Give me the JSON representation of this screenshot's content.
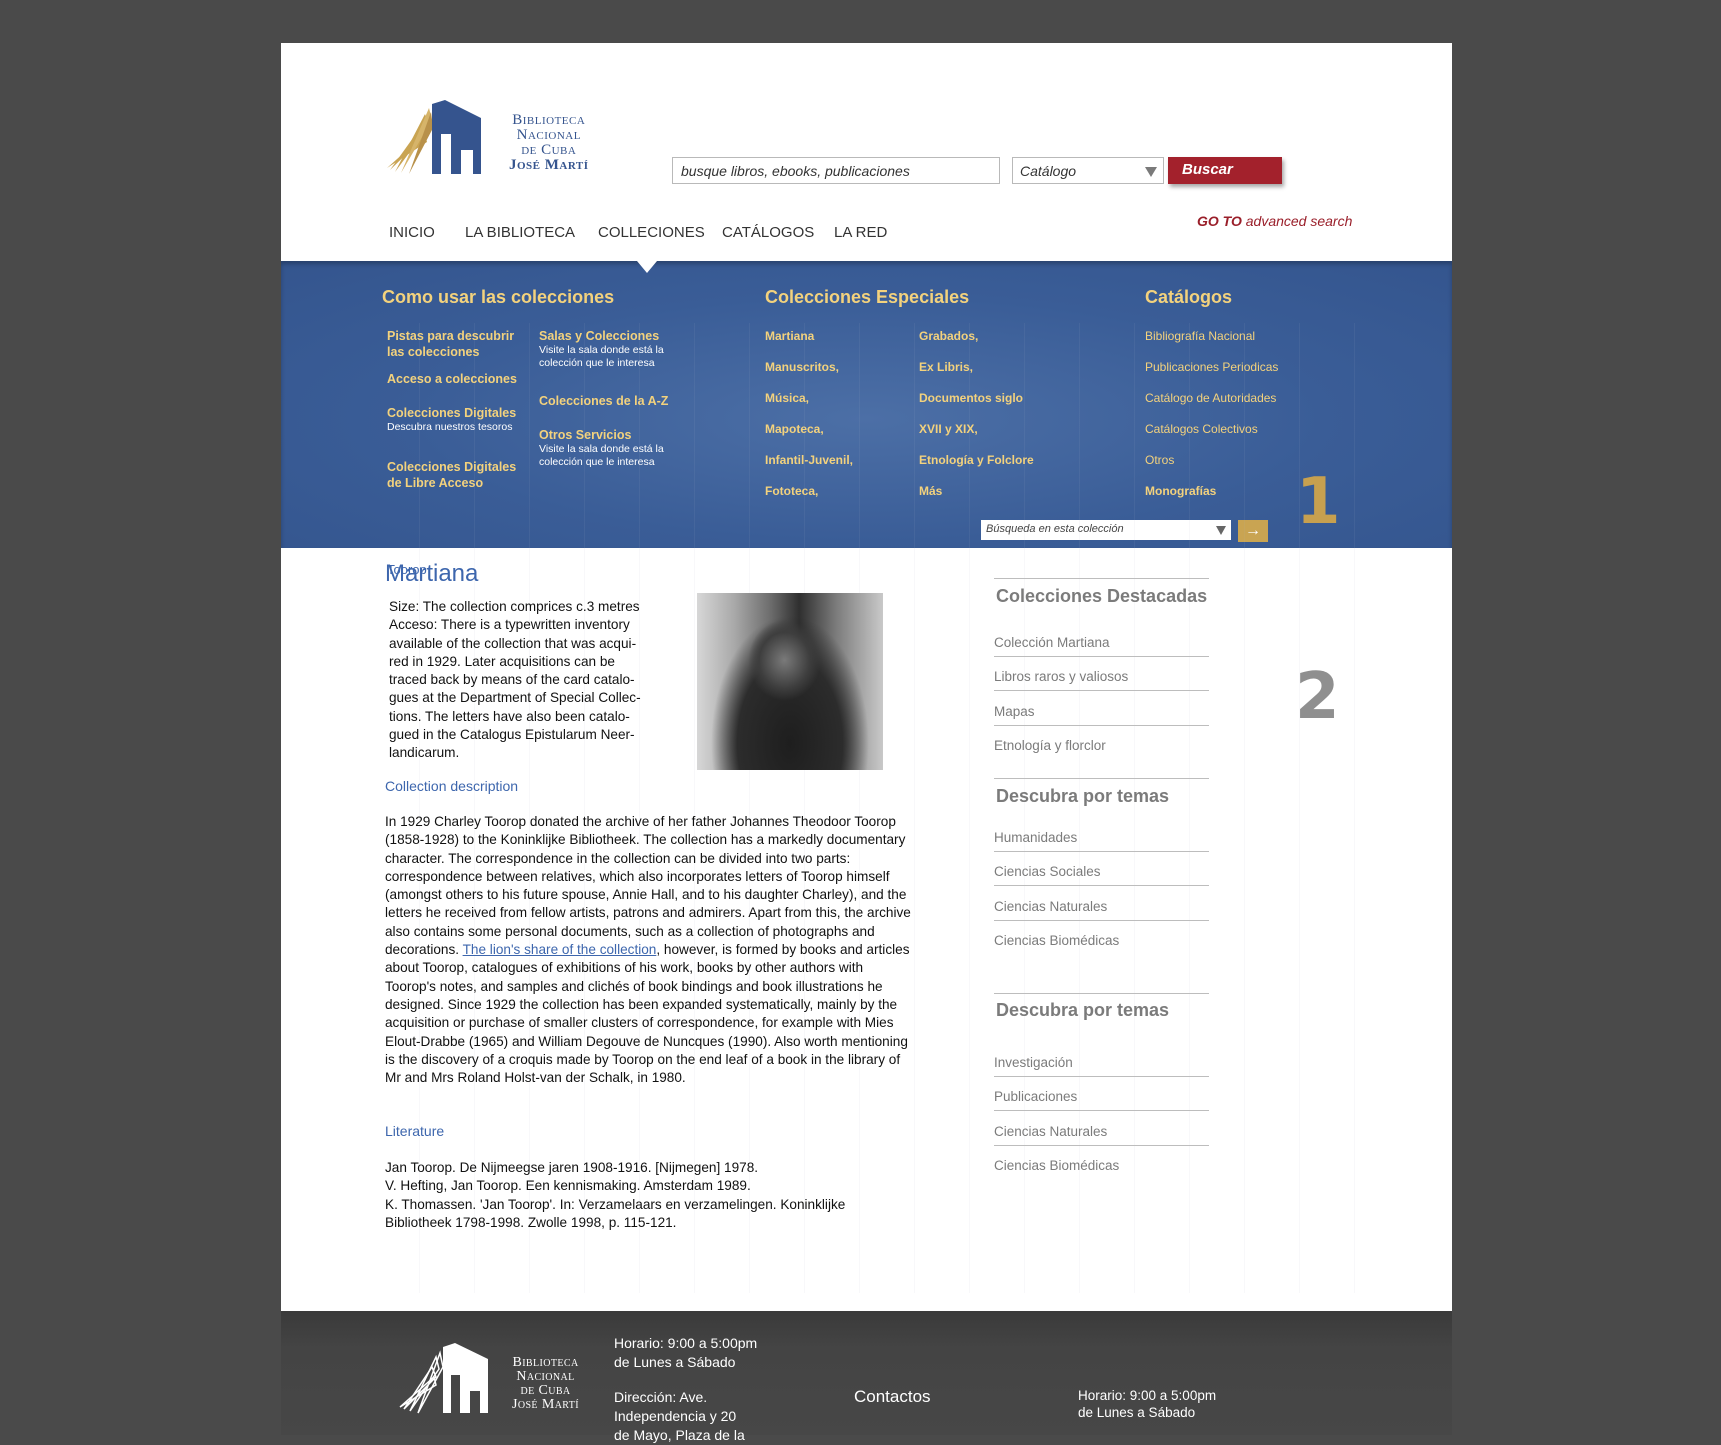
{
  "header": {
    "logo_lines": [
      "Biblioteca",
      "Nacional",
      "de Cuba",
      "José Martí"
    ],
    "search_placeholder": "busque libros, ebooks, publicaciones",
    "catalog_select": "Catálogo",
    "search_button": "Buscar",
    "advanced_go": "GO TO",
    "advanced_text": "advanced search"
  },
  "nav": [
    "INICIO",
    "LA BIBLIOTECA",
    "COLLECIONES",
    "CATÁLOGOS",
    "LA RED"
  ],
  "mega": {
    "col1_title": "Como usar las colecciones",
    "col1a": [
      {
        "label": "Pistas para descubrir las colecciones",
        "sub": ""
      },
      {
        "label": "Acceso a colecciones",
        "sub": ""
      },
      {
        "label": "Colecciones Digitales",
        "sub": "Descubra nuestros tesoros"
      },
      {
        "label": "Colecciones Digitales de Libre Acceso",
        "sub": ""
      }
    ],
    "col1b": [
      {
        "label": "Salas y Colecciones",
        "sub": "Visite la sala donde está la colección que le interesa"
      },
      {
        "label": "Colecciones de la A-Z",
        "sub": ""
      },
      {
        "label": "Otros Servicios",
        "sub": "Visite la sala donde está la colección que le interesa"
      }
    ],
    "col2_title": "Colecciones Especiales",
    "col2a": [
      "Martiana",
      "Manuscritos,",
      "Música,",
      "Mapoteca,",
      "Infantil-Juvenil,",
      "Fototeca,"
    ],
    "col2b": [
      "Grabados,",
      "Ex Libris,",
      "Documentos siglo",
      "XVII y XIX,",
      "Etnología y Folclore",
      "Más"
    ],
    "col3_title": "Catálogos",
    "col3": [
      "Bibliografía Nacional",
      "Publicaciones Periodicas",
      "Catálogo de Autoridades",
      "Catálogos Colectivos",
      "Otros",
      "Monografías"
    ],
    "collection_search_placeholder": "Búsqueda en esta colección",
    "go_arrow": "→",
    "marker": "1"
  },
  "content": {
    "overlay_title": "Toorop",
    "title": "Martiana",
    "intro_lines": [
      "Size: The collection comprices c.3 metres",
      "Acceso: There is a typewritten inventory",
      "available of the collection that was acqui-",
      "red in 1929. Later acquisitions can be",
      "traced back by means of the card catalo-",
      "gues at the Department of Special Collec-",
      "tions. The letters have also been catalo-",
      "gued in the Catalogus Epistularum Neer-",
      "landicarum."
    ],
    "collection_description_label": "Collection description",
    "desc_part1": "In 1929 Charley Toorop donated the archive of her father Johannes Theodoor Toorop (1858-1928) to the Koninklijke Bibliotheek. The collection has a markedly documentary character. The correspondence in the collection can be divided into two parts: correspondence between relatives, which also incorporates letters of Toorop himself (amongst others to his future spouse, Annie Hall, and to his daughter Charley), and the letters he received from fellow artists, patrons and admirers. Apart from this, the archive also contains some personal documents, such as a collection of photographs and decorations. ",
    "desc_link": "The lion's share of the collection",
    "desc_part2": ", however, is formed by books and articles about Toorop, catalogues of exhibitions of his work, books by other authors with Toorop's notes, and samples and clichés of book bindings and book illustrations he designed. Since 1929 the collection has been expanded systematically, mainly by the acquisition or purchase of smaller clusters of correspondence, for example with Mies Elout-Drabbe (1965) and William Degouve de Nuncques (1990). Also worth mentioning is the discovery of a croquis made by Toorop on the end leaf of a book in the library of Mr and Mrs Roland Holst-van der Schalk, in 1980.",
    "literature_label": "Literature",
    "literature": [
      "Jan Toorop. De Nijmeegse jaren 1908-1916. [Nijmegen] 1978.",
      "V. Hefting, Jan Toorop. Een kennismaking. Amsterdam 1989.",
      "K. Thomassen. 'Jan Toorop'. In: Verzamelaars en verzamelingen. Koninklijke Bibliotheek 1798-1998. Zwolle 1998, p. 115-121."
    ],
    "marker": "2"
  },
  "sidebar": {
    "featured_title": "Colecciones Destacadas",
    "featured": [
      "Colección Martiana",
      "Libros raros y valiosos",
      "Mapas",
      "Etnología y florclor"
    ],
    "topics_title": "Descubra por temas",
    "topics": [
      "Humanidades",
      "Ciencias Sociales",
      "Ciencias Naturales",
      "Ciencias Biomédicas"
    ],
    "topics2_title": "Descubra por temas",
    "topics2": [
      "Investigación",
      "Publicaciones",
      "Ciencias Naturales",
      "Ciencias Biomédicas"
    ]
  },
  "footer": {
    "hours_line1": "Horario: 9:00 a 5:00pm",
    "hours_line2": "de Lunes a Sábado",
    "address_line1": "Dirección: Ave.",
    "address_line2": "Independencia y 20",
    "address_line3": "de Mayo, Plaza de la",
    "contacts": "Contactos",
    "hours2_line1": "Horario: 9:00 a 5:00pm",
    "hours2_line2": "de Lunes a Sábado"
  },
  "colors": {
    "brand_blue": "#3a5d97",
    "accent_red": "#a3212c",
    "gold": "#f3d27d",
    "link_blue": "#3d66ad"
  }
}
